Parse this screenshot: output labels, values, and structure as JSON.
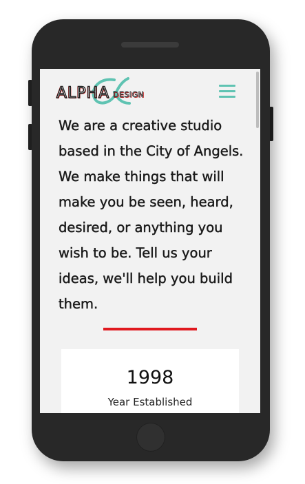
{
  "brand": {
    "name_main": "ALPHA",
    "name_sub": "DESIGN",
    "symbol": "α"
  },
  "header": {
    "menu_icon": "hamburger-menu-icon"
  },
  "main": {
    "intro_text": "We are a creative studio based in the City of Angels. We make things that will make you be seen, heard, desired, or anything you wish to be. Tell us your ideas, we'll help you build them."
  },
  "stats": [
    {
      "value": "1998",
      "label": "Year Established"
    }
  ],
  "colors": {
    "accent_teal": "#5fc3b2",
    "accent_red": "#e0191f",
    "screen_background": "#f2f2f2",
    "device_body": "#282828"
  }
}
